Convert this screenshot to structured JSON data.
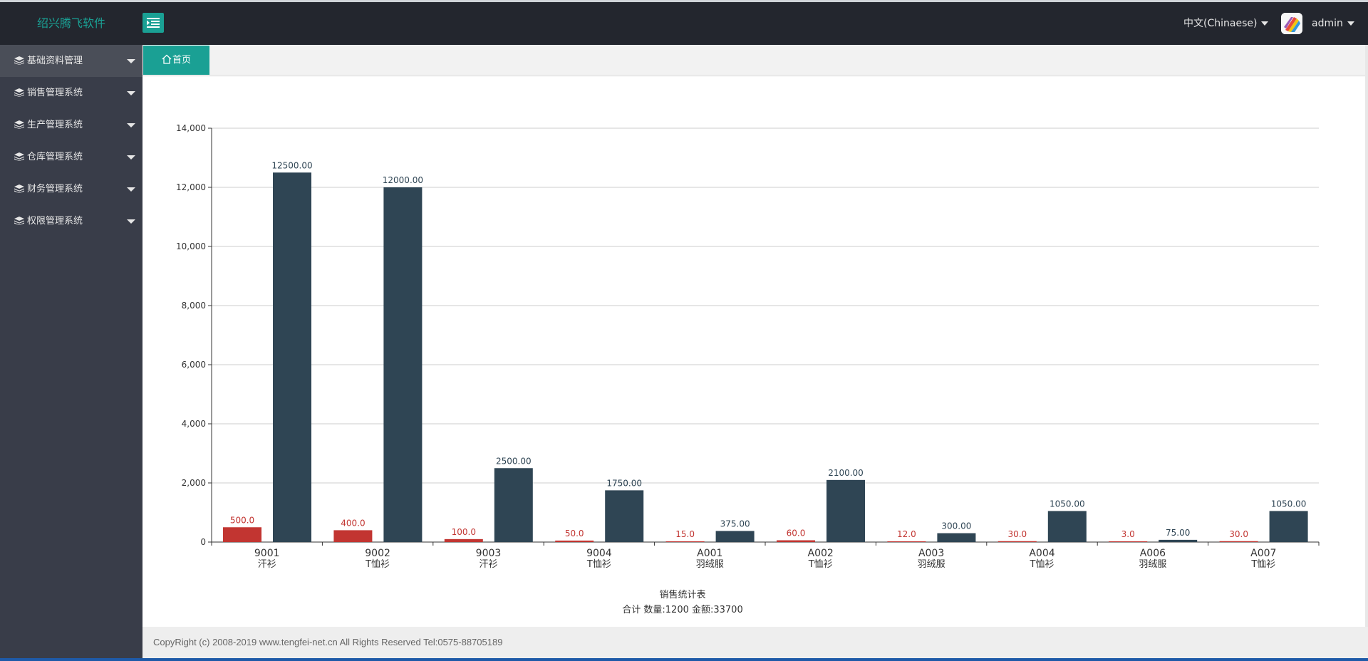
{
  "app": {
    "brand": "绍兴腾飞软件",
    "language": "中文(Chinaese)",
    "user": "admin"
  },
  "colors": {
    "accent": "#1aa094",
    "topbar": "#23262e",
    "sidebar": "#393d49",
    "qty_series": "#c23531",
    "amount_series": "#2f4554"
  },
  "icons": {
    "menu_toggle": "menu-fold-icon",
    "sidebar": "layers-icon",
    "home": "home-icon"
  },
  "sidebar": {
    "items": [
      {
        "label": "基础资料管理"
      },
      {
        "label": "销售管理系统"
      },
      {
        "label": "生产管理系统"
      },
      {
        "label": "仓库管理系统"
      },
      {
        "label": "财务管理系统"
      },
      {
        "label": "权限管理系统"
      }
    ]
  },
  "tabs": [
    {
      "label": "首页"
    }
  ],
  "chart_data": {
    "type": "bar",
    "title": "销售统计表",
    "subtitle": "合计 数量:1200 金额:33700",
    "categories": [
      [
        "9001",
        "汗衫"
      ],
      [
        "9002",
        "T恤衫"
      ],
      [
        "9003",
        "汗衫"
      ],
      [
        "9004",
        "T恤衫"
      ],
      [
        "A001",
        "羽绒服"
      ],
      [
        "A002",
        "T恤衫"
      ],
      [
        "A003",
        "羽绒服"
      ],
      [
        "A004",
        "T恤衫"
      ],
      [
        "A006",
        "羽绒服"
      ],
      [
        "A007",
        "T恤衫"
      ]
    ],
    "series": [
      {
        "values": [
          500,
          400,
          100,
          50,
          15,
          60,
          12,
          30,
          3,
          30
        ],
        "labels": [
          "500.0",
          "400.0",
          "100.0",
          "50.0",
          "15.0",
          "60.0",
          "12.0",
          "30.0",
          "3.0",
          "30.0"
        ],
        "color": "#c23531"
      },
      {
        "values": [
          12500,
          12000,
          2500,
          1750,
          375,
          2100,
          300,
          1050,
          75,
          1050
        ],
        "labels": [
          "12500.00",
          "12000.00",
          "2500.00",
          "1750.00",
          "375.00",
          "2100.00",
          "300.00",
          "1050.00",
          "75.00",
          "1050.00"
        ],
        "color": "#2f4554"
      }
    ],
    "yticks": [
      "0",
      "2,000",
      "4,000",
      "6,000",
      "8,000",
      "10,000",
      "12,000",
      "14,000"
    ],
    "ylim": [
      0,
      14000
    ],
    "grid": true
  },
  "footer": {
    "text": "CopyRight (c) 2008-2019 www.tengfei-net.cn All Rights Reserved Tel:0575-88705189"
  }
}
